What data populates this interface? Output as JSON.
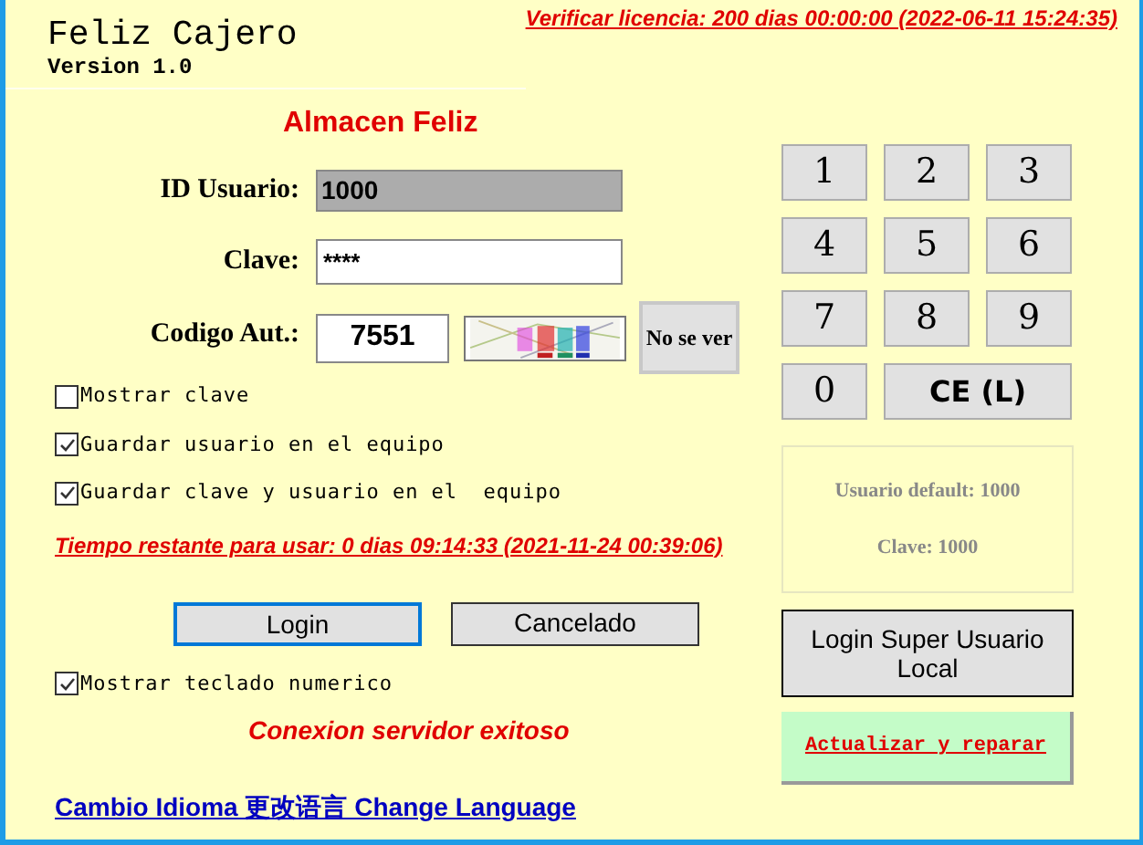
{
  "app": {
    "title": "Feliz Cajero",
    "version": "Version 1.0",
    "license": "Verificar licencia: 200 dias 00:00:00 (2022-06-11 15:24:35)",
    "store": "Almacen Feliz"
  },
  "form": {
    "user_label": "ID Usuario:",
    "user_value": "1000",
    "password_label": "Clave:",
    "password_value": "****",
    "code_label": "Codigo Aut.:",
    "code_value": "7551",
    "cant_see_button": "No se ver"
  },
  "options": [
    {
      "label": "Mostrar clave",
      "checked": false
    },
    {
      "label": "Guardar usuario en el equipo",
      "checked": true
    },
    {
      "label": "Guardar clave y usuario en el  equipo",
      "checked": true
    }
  ],
  "remaining_time": "Tiempo restante para usar: 0 dias 09:14:33 (2021-11-24 00:39:06)",
  "buttons": [
    {
      "label": "Login",
      "focused": true
    },
    {
      "label": "Cancelado",
      "focused": false
    }
  ],
  "keypad_option": {
    "label": "Mostrar teclado numerico",
    "checked": true
  },
  "status": "Conexion servidor exitoso",
  "language_link": "Cambio Idioma 更改语言 Change Language",
  "keypad": [
    {
      "label": "1",
      "kind": "digit"
    },
    {
      "label": "2",
      "kind": "digit"
    },
    {
      "label": "3",
      "kind": "digit"
    },
    {
      "label": "4",
      "kind": "digit"
    },
    {
      "label": "5",
      "kind": "digit"
    },
    {
      "label": "6",
      "kind": "digit"
    },
    {
      "label": "7",
      "kind": "digit"
    },
    {
      "label": "8",
      "kind": "digit"
    },
    {
      "label": "9",
      "kind": "digit"
    },
    {
      "label": "0",
      "kind": "digit"
    },
    {
      "label": "CE (L)",
      "kind": "clear"
    }
  ],
  "defaults": [
    "Usuario default: 1000",
    "Clave: 1000"
  ],
  "super_user_button": "Login Super Usuario Local",
  "repair_button": "Actualizar y reparar"
}
